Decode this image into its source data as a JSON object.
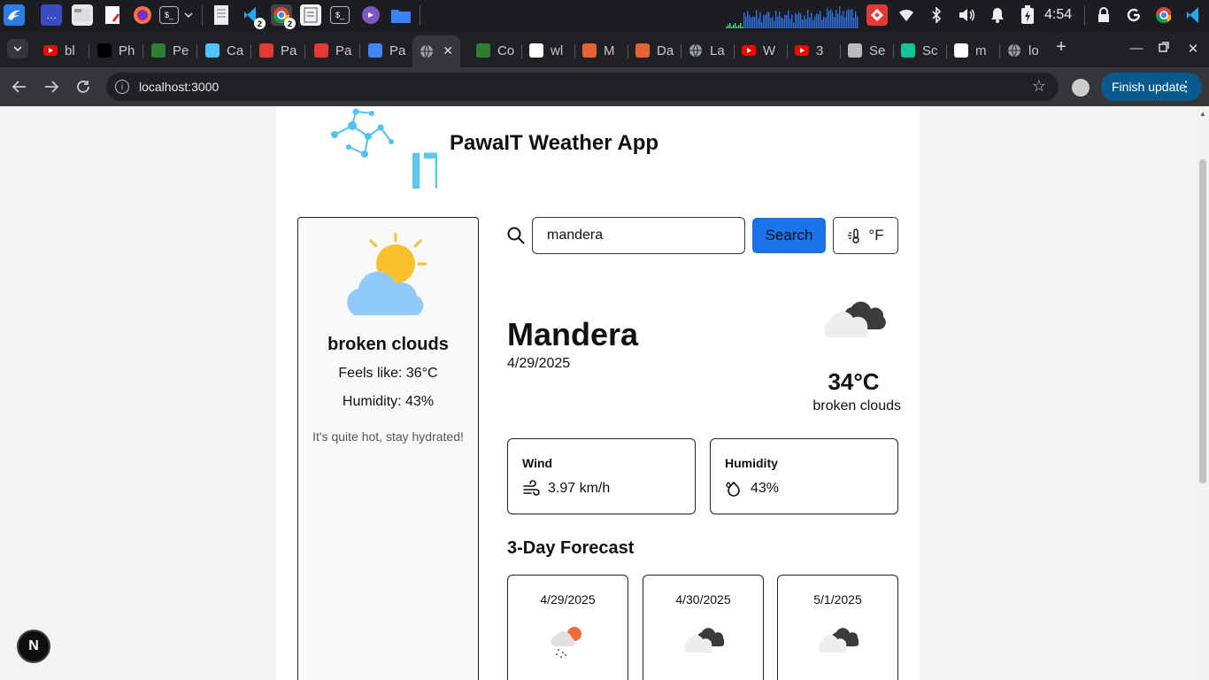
{
  "os": {
    "clock": "4:54",
    "taskbar_badges": {
      "vscode": "2",
      "chrome": "2"
    }
  },
  "browser": {
    "tabs": [
      {
        "title": "bl",
        "icon": "youtube-icon",
        "color": "#ff0000"
      },
      {
        "title": "Ph",
        "icon": "producthunt-icon",
        "color": "#000000"
      },
      {
        "title": "Pe",
        "icon": "perplexity-icon",
        "color": "#2e7d32"
      },
      {
        "title": "Ca",
        "icon": "calendar-icon",
        "color": "#4fc3f7"
      },
      {
        "title": "Pa",
        "icon": "location-pin-icon",
        "color": "#e53935"
      },
      {
        "title": "Pa",
        "icon": "location-pin-icon",
        "color": "#e53935"
      },
      {
        "title": "Pa",
        "icon": "docs-icon",
        "color": "#4285f4"
      },
      {
        "title": "",
        "icon": "globe-icon",
        "color": "#9aa0a6",
        "active": true
      },
      {
        "title": "Co",
        "icon": "copilot-icon",
        "color": "#2e7d32"
      },
      {
        "title": "wl",
        "icon": "google-icon",
        "color": "#ffffff"
      },
      {
        "title": "M",
        "icon": "mascot-icon",
        "color": "#e8622c"
      },
      {
        "title": "Da",
        "icon": "mascot-icon",
        "color": "#e8622c"
      },
      {
        "title": "La",
        "icon": "globe-icon",
        "color": "#9aa0a6"
      },
      {
        "title": "W",
        "icon": "youtube-icon",
        "color": "#ff0000"
      },
      {
        "title": "3",
        "icon": "youtube-icon",
        "color": "#ff0000"
      },
      {
        "title": "Se",
        "icon": "gear-icon",
        "color": "#bbbbbb"
      },
      {
        "title": "Sc",
        "icon": "grammarly-icon",
        "color": "#15c39a"
      },
      {
        "title": "m",
        "icon": "github-icon",
        "color": "#ffffff"
      },
      {
        "title": "lo",
        "icon": "globe-icon",
        "color": "#9aa0a6"
      }
    ],
    "url": "localhost:3000",
    "update_label": "Finish update"
  },
  "app": {
    "title": "PawaIT Weather App",
    "logo_text": "IT",
    "search": {
      "value": "mandera",
      "button_label": "Search"
    },
    "unit_toggle_label": "°F",
    "sidebar": {
      "description": "broken clouds",
      "feels_like": "Feels like: 36°C",
      "humidity": "Humidity: 43%",
      "tip": "It's quite hot, stay hydrated!"
    },
    "current": {
      "city": "Mandera",
      "date": "4/29/2025",
      "temp": "34°C",
      "description": "broken clouds",
      "icon": "broken-clouds-icon"
    },
    "stats": {
      "wind": {
        "label": "Wind",
        "value": "3.97 km/h"
      },
      "humidity": {
        "label": "Humidity",
        "value": "43%"
      }
    },
    "forecast_title": "3-Day Forecast",
    "forecast": [
      {
        "date": "4/29/2025",
        "icon": "rain-sun-icon"
      },
      {
        "date": "4/30/2025",
        "icon": "broken-clouds-icon"
      },
      {
        "date": "5/1/2025",
        "icon": "broken-clouds-icon"
      }
    ]
  },
  "dev_badge": "N"
}
